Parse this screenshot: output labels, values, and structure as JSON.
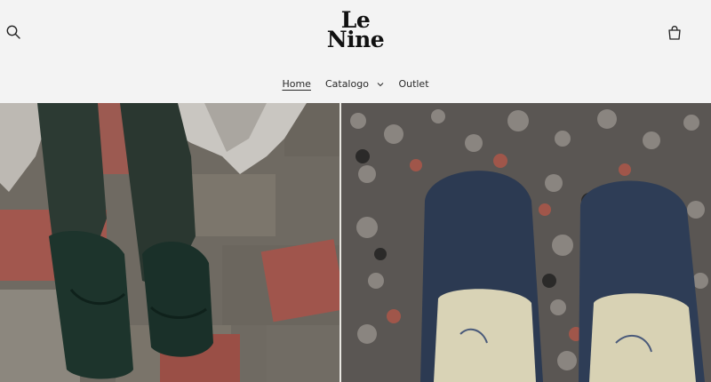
{
  "brand": {
    "line1": "Le",
    "line2": "Nine"
  },
  "nav": {
    "home": "Home",
    "catalogo": "Catalogo",
    "outlet": "Outlet"
  },
  "icons": {
    "search": "search-icon",
    "cart": "bag-icon",
    "chevron": "chevron-down-icon"
  },
  "colors": {
    "header_bg": "#f3f3f3",
    "text": "#121212",
    "shoe_left": "#1f3a2f",
    "shoe_right": "#2e3f56"
  }
}
